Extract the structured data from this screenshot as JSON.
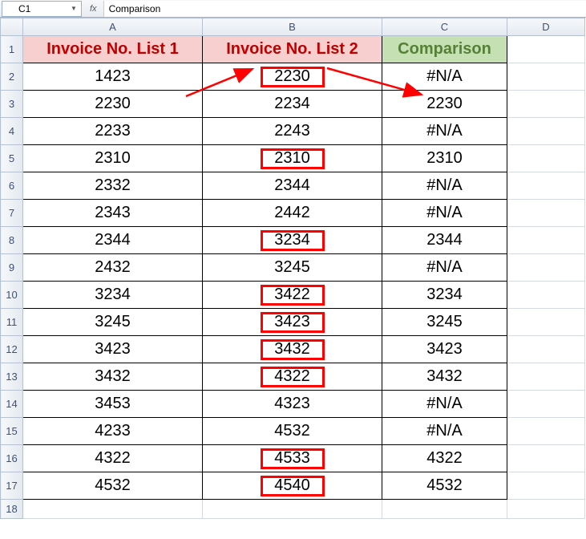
{
  "formula_bar": {
    "name_box": "C1",
    "fx_label": "fx",
    "formula": "Comparison"
  },
  "columns": [
    "A",
    "B",
    "C",
    "D"
  ],
  "headers": {
    "a": "Invoice No. List 1",
    "b": "Invoice No. List 2",
    "c": "Comparison"
  },
  "rows": [
    {
      "r": 2,
      "a": "1423",
      "b": "2230",
      "c": "#N/A",
      "box_b": true
    },
    {
      "r": 3,
      "a": "2230",
      "b": "2234",
      "c": "2230",
      "box_b": false
    },
    {
      "r": 4,
      "a": "2233",
      "b": "2243",
      "c": "#N/A",
      "box_b": false
    },
    {
      "r": 5,
      "a": "2310",
      "b": "2310",
      "c": "2310",
      "box_b": true
    },
    {
      "r": 6,
      "a": "2332",
      "b": "2344",
      "c": "#N/A",
      "box_b": false
    },
    {
      "r": 7,
      "a": "2343",
      "b": "2442",
      "c": "#N/A",
      "box_b": false
    },
    {
      "r": 8,
      "a": "2344",
      "b": "3234",
      "c": "2344",
      "box_b": true
    },
    {
      "r": 9,
      "a": "2432",
      "b": "3245",
      "c": "#N/A",
      "box_b": false
    },
    {
      "r": 10,
      "a": "3234",
      "b": "3422",
      "c": "3234",
      "box_b": true
    },
    {
      "r": 11,
      "a": "3245",
      "b": "3423",
      "c": "3245",
      "box_b": true
    },
    {
      "r": 12,
      "a": "3423",
      "b": "3432",
      "c": "3423",
      "box_b": true
    },
    {
      "r": 13,
      "a": "3432",
      "b": "4322",
      "c": "3432",
      "box_b": true
    },
    {
      "r": 14,
      "a": "3453",
      "b": "4323",
      "c": "#N/A",
      "box_b": false
    },
    {
      "r": 15,
      "a": "4233",
      "b": "4532",
      "c": "#N/A",
      "box_b": false
    },
    {
      "r": 16,
      "a": "4322",
      "b": "4533",
      "c": "4322",
      "box_b": true
    },
    {
      "r": 17,
      "a": "4532",
      "b": "4540",
      "c": "4532",
      "box_b": true
    }
  ],
  "last_row_num": 18,
  "chart_data": {
    "type": "table",
    "title": "Comparison of two invoice number lists (Excel spreadsheet)",
    "columns": [
      "Invoice No. List 1",
      "Invoice No. List 2",
      "Comparison"
    ],
    "data": [
      [
        1423,
        2230,
        "#N/A"
      ],
      [
        2230,
        2234,
        2230
      ],
      [
        2233,
        2243,
        "#N/A"
      ],
      [
        2310,
        2310,
        2310
      ],
      [
        2332,
        2344,
        "#N/A"
      ],
      [
        2343,
        2442,
        "#N/A"
      ],
      [
        2344,
        3234,
        2344
      ],
      [
        2432,
        3245,
        "#N/A"
      ],
      [
        3234,
        3422,
        3234
      ],
      [
        3245,
        3423,
        3245
      ],
      [
        3423,
        3432,
        3423
      ],
      [
        3432,
        4322,
        3432
      ],
      [
        3453,
        4323,
        "#N/A"
      ],
      [
        4233,
        4532,
        "#N/A"
      ],
      [
        4322,
        4533,
        4322
      ],
      [
        4532,
        4540,
        4532
      ]
    ],
    "highlighted_b_rows": [
      2,
      5,
      8,
      10,
      11,
      12,
      13,
      16,
      17
    ],
    "arrows": [
      {
        "from": "A3 (2230)",
        "to": "B2 (2230)"
      },
      {
        "from": "B2 (2230)",
        "to": "C3 (2230)"
      }
    ]
  }
}
